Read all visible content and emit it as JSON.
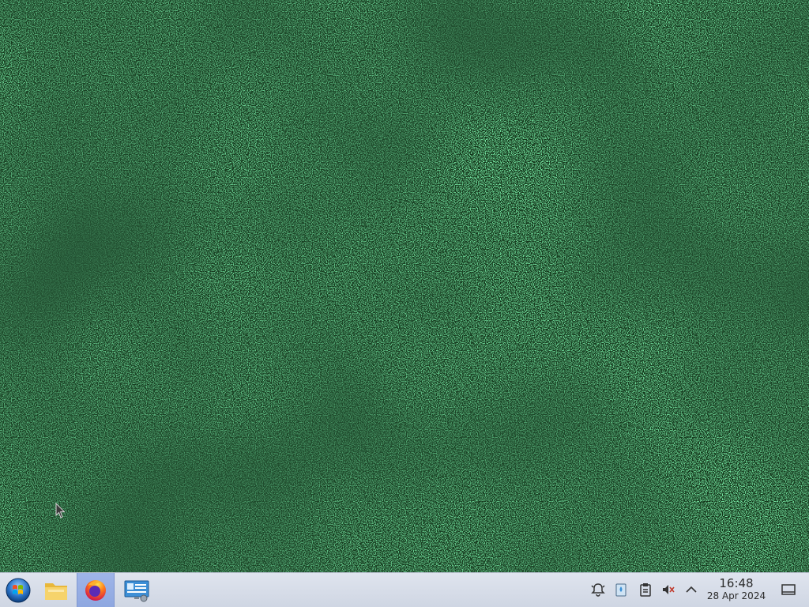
{
  "desktop": {
    "wallpaper": {
      "base_color": "#0f2a14",
      "speckle_colors": [
        "#2fae55",
        "#3ccf67",
        "#1f7a3a",
        "#49d672"
      ]
    }
  },
  "taskbar": {
    "background": "#d9dfea",
    "launchers": [
      {
        "icon": "start-menu-orb-icon",
        "active": false
      },
      {
        "icon": "file-manager-folder-icon",
        "active": false
      },
      {
        "icon": "firefox-icon",
        "active": true
      },
      {
        "icon": "system-settings-icon",
        "active": false
      }
    ],
    "tray": {
      "icons": [
        "notification-bell-icon",
        "clipboard-drop-icon",
        "clipboard-icon",
        "volume-muted-icon",
        "show-hidden-arrow-icon"
      ],
      "clock": {
        "time": "16:48",
        "date": "28 Apr 2024"
      },
      "show_desktop_icon": "show-desktop-icon"
    }
  }
}
